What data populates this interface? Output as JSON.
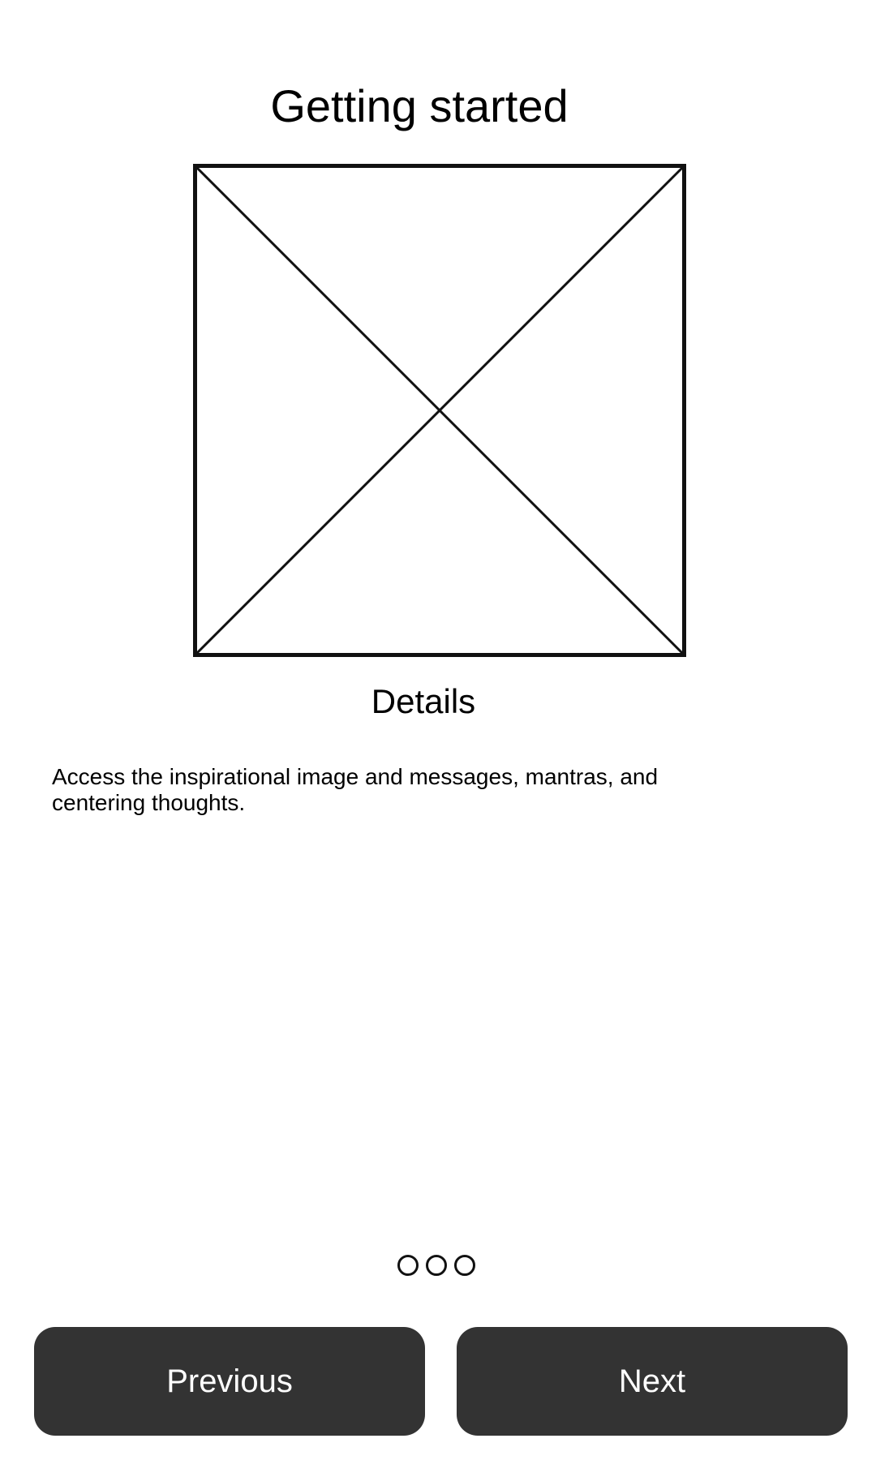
{
  "screen": {
    "title": "Getting started",
    "image": {
      "icon": "image-placeholder-icon",
      "stroke_color": "#111111"
    },
    "details_heading": "Details",
    "description": "Access the inspirational image and messages, mantras, and centering thoughts.",
    "pager": {
      "total_pages": 3,
      "dot_icon": "circle-outline-icon"
    },
    "buttons": {
      "previous_label": "Previous",
      "next_label": "Next",
      "background_color": "#333333",
      "text_color": "#ffffff"
    }
  }
}
